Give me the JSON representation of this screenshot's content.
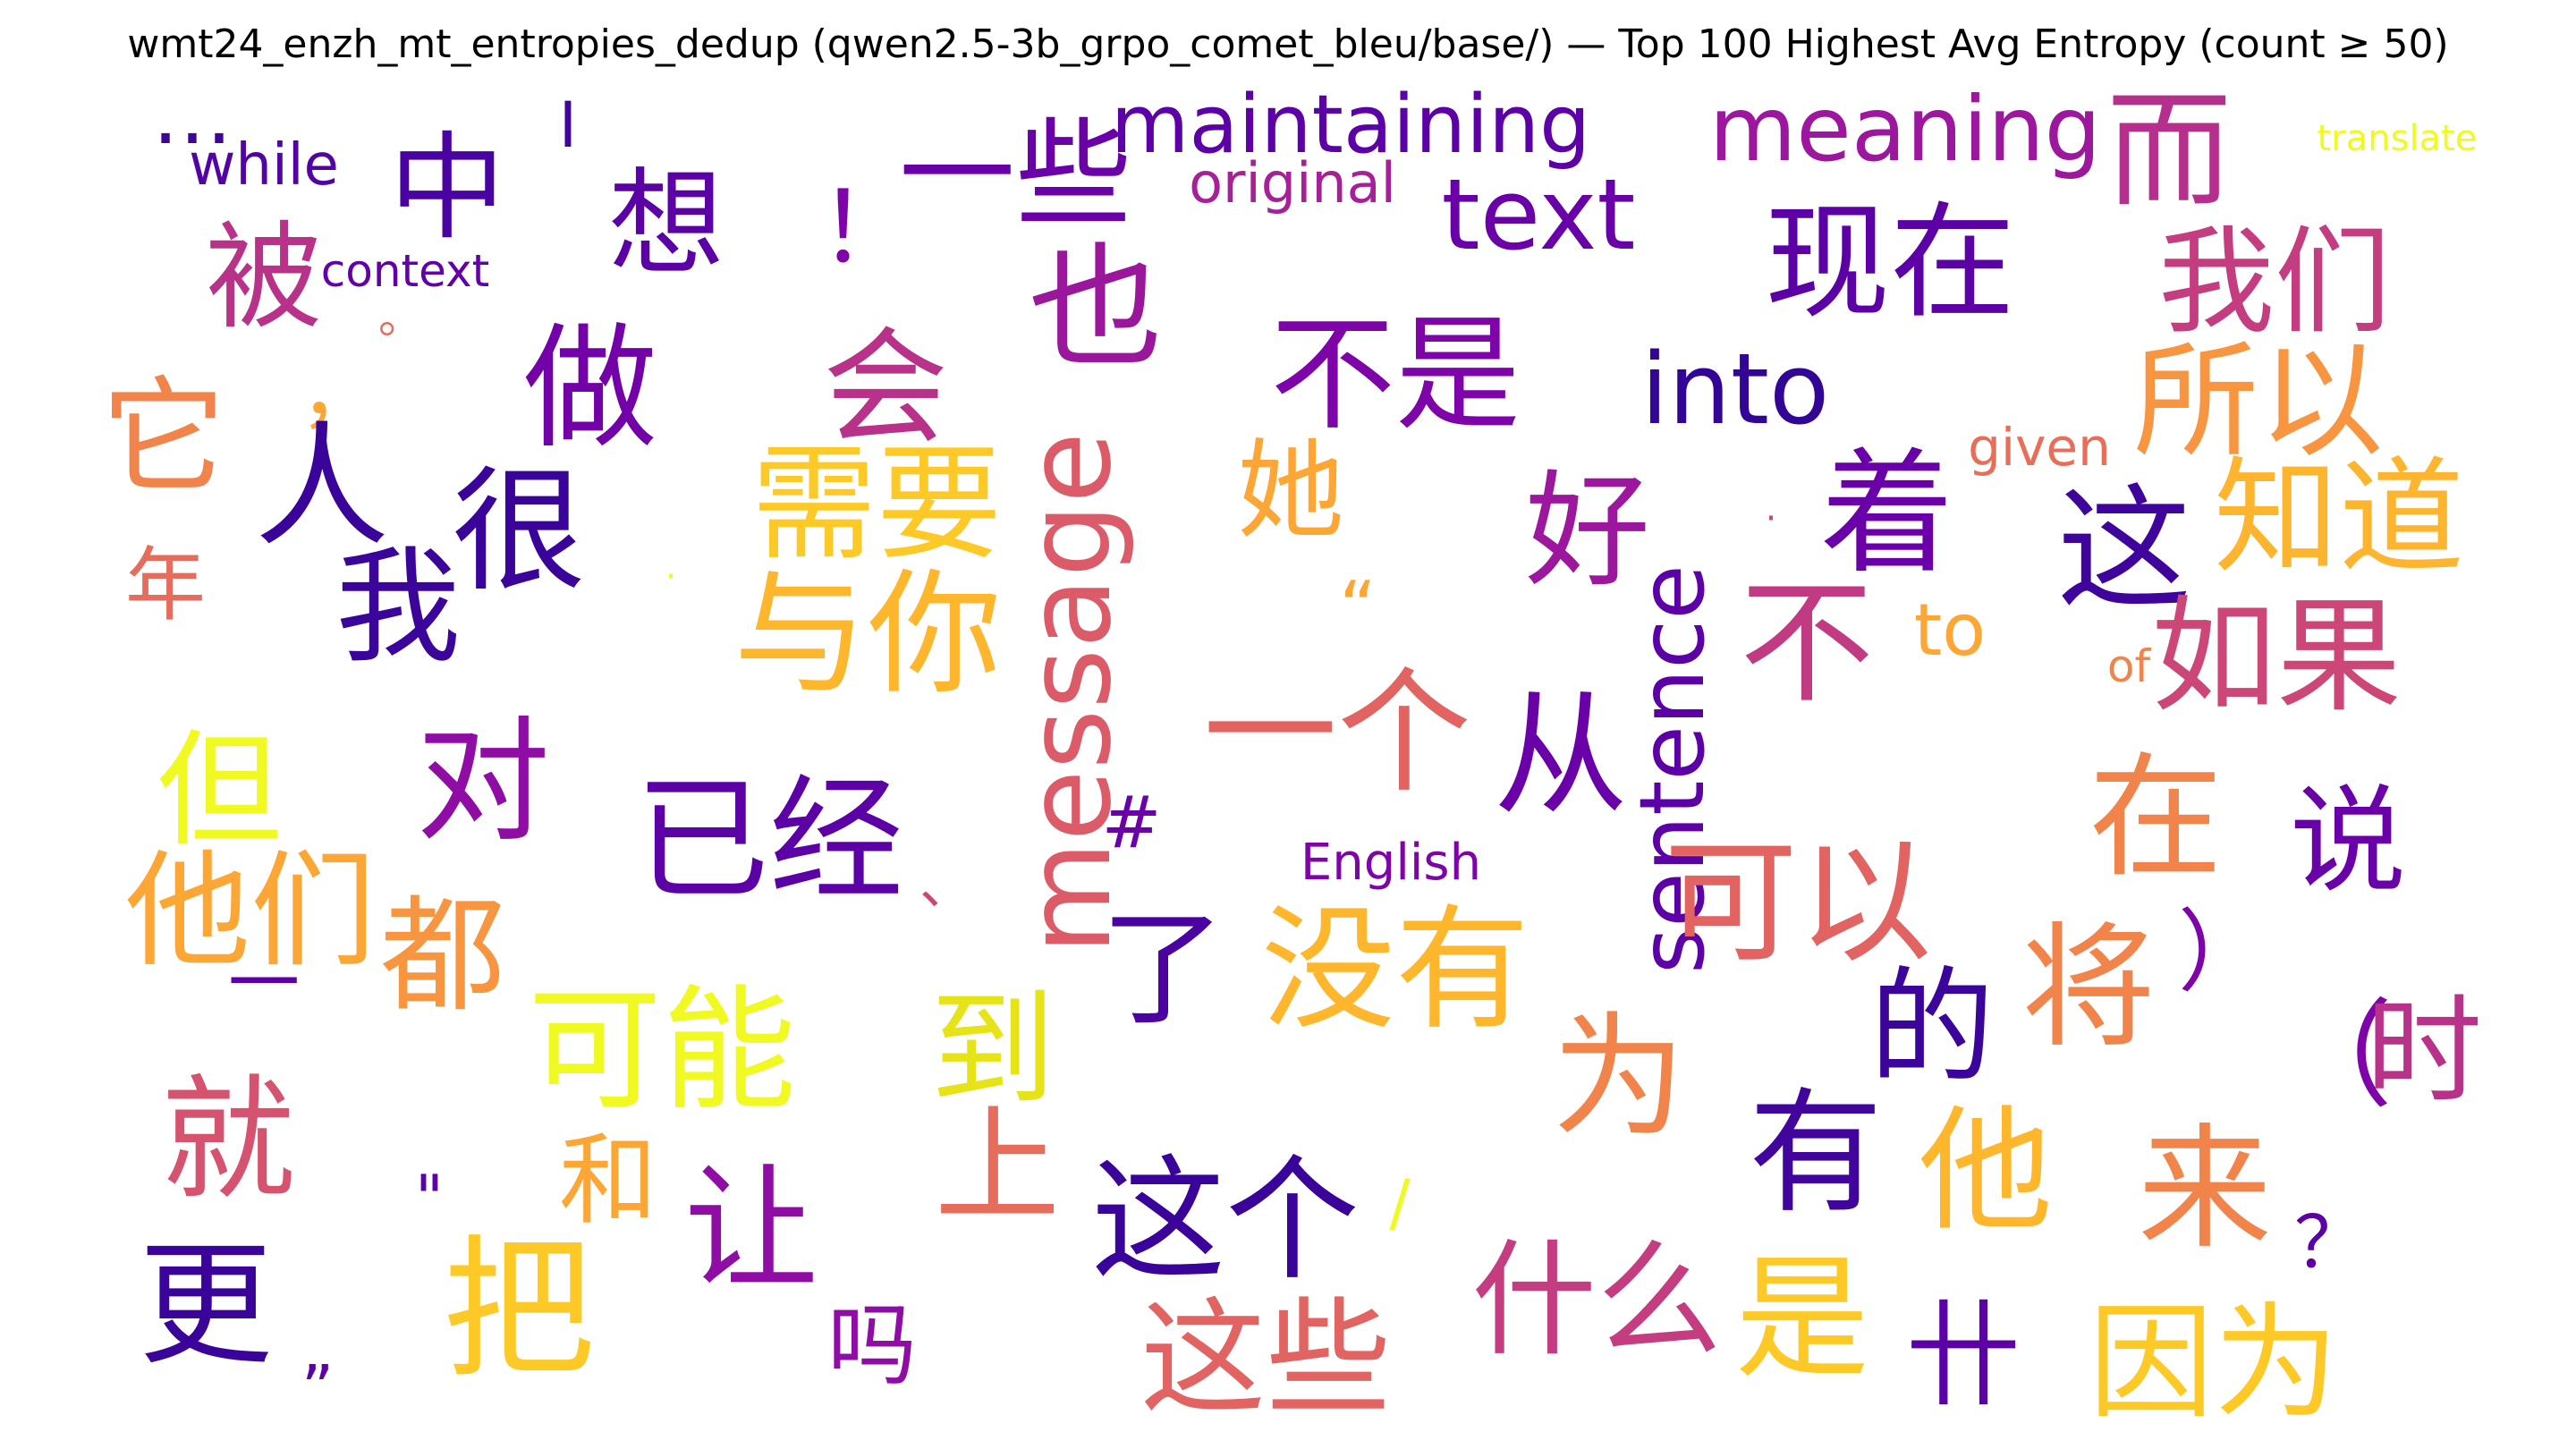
{
  "title": "wmt24_enzh_mt_entropies_dedup (qwen2.5-3b_grpo_comet_bleu/base/) — Top 100 Highest Avg Entropy (count ≥ 50)",
  "words": [
    {
      "text": "…",
      "color": "#3f0599"
    },
    {
      "text": "I",
      "color": "#41049d"
    },
    {
      "text": "while",
      "color": "#5302a3"
    },
    {
      "text": "中",
      "color": "#4903a0"
    },
    {
      "text": "想",
      "color": "#5c01a6"
    },
    {
      "text": "！",
      "color": "#7e03a8"
    },
    {
      "text": "一些",
      "color": "#6a00a8"
    },
    {
      "text": "maintaining",
      "color": "#5b01a5"
    },
    {
      "text": "original",
      "color": "#a62098"
    },
    {
      "text": "text",
      "color": "#6a00a8"
    },
    {
      "text": "meaning",
      "color": "#9c179e"
    },
    {
      "text": "而",
      "color": "#b52f8c"
    },
    {
      "text": "translate",
      "color": "#f0f921"
    },
    {
      "text": "被",
      "color": "#b83289"
    },
    {
      "text": "context",
      "color": "#6300a7"
    },
    {
      "text": "。",
      "color": "#e66c5c"
    },
    {
      "text": "也",
      "color": "#9a179b"
    },
    {
      "text": "现在",
      "color": "#5c01a6"
    },
    {
      "text": "我们",
      "color": "#c33d80"
    },
    {
      "text": "，",
      "color": "#fca636"
    },
    {
      "text": "做",
      "color": "#7201a8"
    },
    {
      "text": "会",
      "color": "#b83289"
    },
    {
      "text": "不是",
      "color": "#7e03a8"
    },
    {
      "text": "into",
      "color": "#330597"
    },
    {
      "text": "所以",
      "color": "#f89540"
    },
    {
      "text": "它",
      "color": "#f1844b"
    },
    {
      "text": "人",
      "color": "#3a049a"
    },
    {
      "text": "很",
      "color": "#3a049a"
    },
    {
      "text": "需要",
      "color": "#fdc926"
    },
    {
      "text": "message",
      "color": "#db5c68"
    },
    {
      "text": "她",
      "color": "#fca636"
    },
    {
      "text": "好",
      "color": "#9c179e"
    },
    {
      "text": "·",
      "color": "#cc4778"
    },
    {
      "text": "着",
      "color": "#6a00a8"
    },
    {
      "text": "given",
      "color": "#e76f5a"
    },
    {
      "text": "这",
      "color": "#3e049c"
    },
    {
      "text": "知道",
      "color": "#fdb42f"
    },
    {
      "text": "年",
      "color": "#e66c5c"
    },
    {
      "text": "我",
      "color": "#3b049a"
    },
    {
      "text": "·",
      "color": "#f0f921"
    },
    {
      "text": "与你",
      "color": "#feb72d"
    },
    {
      "text": "“",
      "color": "#fca636"
    },
    {
      "text": "sentence",
      "color": "#5c01a6"
    },
    {
      "text": "不",
      "color": "#c13b82"
    },
    {
      "text": "to",
      "color": "#fca636"
    },
    {
      "text": "of",
      "color": "#f1844b"
    },
    {
      "text": "如果",
      "color": "#cc4778"
    },
    {
      "text": "一个",
      "color": "#e16462"
    },
    {
      "text": "从",
      "color": "#6a00a8"
    },
    {
      "text": "但",
      "color": "#f0f921"
    },
    {
      "text": "对",
      "color": "#8f0da4"
    },
    {
      "text": "已经",
      "color": "#5c01a6"
    },
    {
      "text": "、",
      "color": "#cc4778"
    },
    {
      "text": "#",
      "color": "#6a00a8"
    },
    {
      "text": "English",
      "color": "#7e03a8"
    },
    {
      "text": "在",
      "color": "#f1844b"
    },
    {
      "text": "说",
      "color": "#6a00a8"
    },
    {
      "text": "他们",
      "color": "#fca636"
    },
    {
      "text": "都",
      "color": "#f89540"
    },
    {
      "text": "可以",
      "color": "#e16462"
    },
    {
      "text": "一",
      "color": "#5c01a6"
    },
    {
      "text": "了",
      "color": "#4c02a1"
    },
    {
      "text": "没有",
      "color": "#feb72d"
    },
    {
      "text": "将",
      "color": "#f1844b"
    },
    {
      "text": "）",
      "color": "#7e03a8"
    },
    {
      "text": "的",
      "color": "#3b049a"
    },
    {
      "text": "可能",
      "color": "#f0f921"
    },
    {
      "text": "到",
      "color": "#e6e419"
    },
    {
      "text": "为",
      "color": "#f1844b"
    },
    {
      "text": "（",
      "color": "#7e03a8"
    },
    {
      "text": "时",
      "color": "#b83289"
    },
    {
      "text": "就",
      "color": "#d5536f"
    },
    {
      "text": "上",
      "color": "#e66c5c"
    },
    {
      "text": "和",
      "color": "#fca636"
    },
    {
      "text": "有",
      "color": "#41049d"
    },
    {
      "text": "他",
      "color": "#feb72d"
    },
    {
      "text": "来",
      "color": "#f1844b"
    },
    {
      "text": "\"",
      "color": "#5c01a6"
    },
    {
      "text": "让",
      "color": "#8f0da4"
    },
    {
      "text": "这个",
      "color": "#3a049a"
    },
    {
      "text": "/",
      "color": "#f0f921"
    },
    {
      "text": "更",
      "color": "#3a049a"
    },
    {
      "text": "？",
      "color": "#5c01a6"
    },
    {
      "text": "把",
      "color": "#fdc926"
    },
    {
      "text": "什么",
      "color": "#c33d80"
    },
    {
      "text": "是",
      "color": "#fdc926"
    },
    {
      "text": "卄",
      "color": "#5c01a6"
    },
    {
      "text": "因为",
      "color": "#fdc926"
    },
    {
      "text": "吗",
      "color": "#8f0da4"
    },
    {
      "text": "这些",
      "color": "#e16462"
    },
    {
      "text": "„",
      "color": "#5c01a6"
    }
  ]
}
